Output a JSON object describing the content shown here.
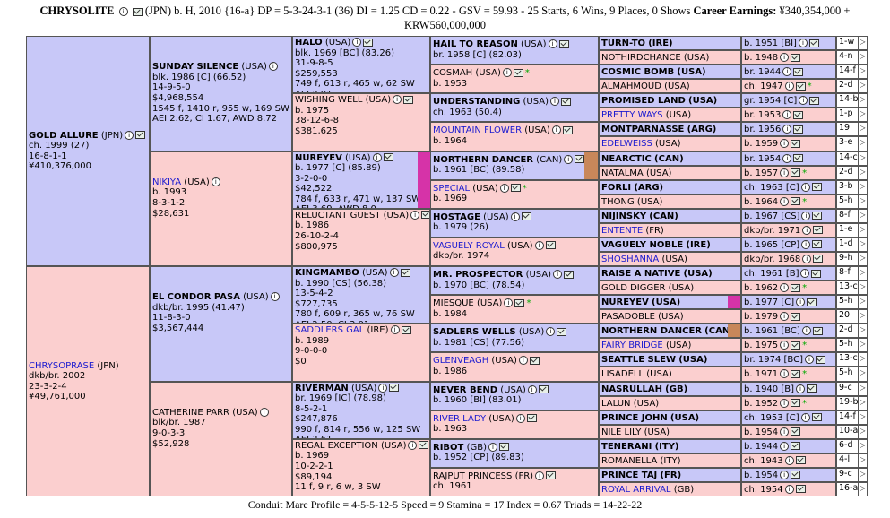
{
  "header": {
    "horse": "CHRYSOLITE",
    "line1": "(JPN) b. H, 2010 {16-a} DP = 5-3-24-3-1 (36) DI = 1.25   CD = 0.22 - GSV = 59.93 - 25 Starts, 6 Wins, 9 Places, 0 Shows",
    "earn_label": "Career Earnings:",
    "earn_value": "¥340,354,000 +",
    "line2": "KRW560,000,000"
  },
  "footer": "Conduit Mare Profile = 4-5-5-12-5   Speed = 9   Stamina = 17   Index = 0.67   Triads = 14-22-22",
  "gen1": {
    "sire": {
      "name": "GOLD ALLURE",
      "country": "(JPN)",
      "l1": "ch. 1999 (27)",
      "l2": "16-8-1-1",
      "l3": "¥410,376,000"
    },
    "dam": {
      "name": "CHRYSOPRASE",
      "country": "(JPN)",
      "l1": "dkb/br. 2002",
      "l2": "23-3-2-4",
      "l3": "¥49,761,000"
    }
  },
  "gen2": [
    {
      "name": "SUNDAY SILENCE",
      "country": "(USA)",
      "lines": [
        "blk. 1986 [C] (66.52)",
        "14-9-5-0",
        "$4,968,554",
        "1545 f, 1410 r, 955 w, 169 SW",
        "AEI 2.62, CI 1.67, AWD 8.72"
      ]
    },
    {
      "name": "NIKIYA",
      "country": "(USA)",
      "lines": [
        "b. 1993",
        "8-3-1-2",
        "$28,631"
      ]
    },
    {
      "name": "EL CONDOR PASA",
      "country": "(USA)",
      "lines": [
        "dkb/br. 1995 (41.47)",
        "11-8-3-0",
        "$3,567,444"
      ]
    },
    {
      "name": "CATHERINE PARR",
      "country": "(USA)",
      "lines": [
        "blk/br. 1987",
        "9-0-3-3",
        "$52,928"
      ]
    }
  ],
  "gen3": [
    {
      "name": "HALO",
      "country": "(USA)",
      "lines": [
        "blk. 1969 [BC] (83.26)",
        "31-9-8-5",
        "$259,553",
        "749 f, 613 r, 465 w, 62 SW",
        "AEI 2.91"
      ]
    },
    {
      "name": "WISHING WELL",
      "country": "(USA)",
      "lines": [
        "b. 1975",
        "38-12-6-8",
        "$381,625"
      ]
    },
    {
      "name": "NUREYEV",
      "country": "(USA)",
      "lines": [
        "b. 1977 [C] (85.89)",
        "3-2-0-0",
        "$42,522",
        "784 f, 633 r, 471 w, 137 SW",
        "AEI 3.69, AWD 8.0"
      ]
    },
    {
      "name": "RELUCTANT GUEST",
      "country": "(USA)",
      "lines": [
        "b. 1986",
        "26-10-2-4",
        "$800,975"
      ]
    },
    {
      "name": "KINGMAMBO",
      "country": "(USA)",
      "lines": [
        "b. 1990 [CS] (56.38)",
        "13-5-4-2",
        "$727,735",
        "780 f, 609 r, 365 w, 76 SW",
        "AEI 2.50, CI 3.01"
      ],
      "extra": "Website"
    },
    {
      "name": "SADDLERS GAL",
      "country": "(IRE)",
      "lines": [
        "b. 1989",
        "9-0-0-0",
        "$0"
      ]
    },
    {
      "name": "RIVERMAN",
      "country": "(USA)",
      "lines": [
        "br. 1969 [IC] (78.98)",
        "8-5-2-1",
        "$247,876",
        "990 f, 814 r, 556 w, 125 SW",
        "AEI 2.61"
      ]
    },
    {
      "name": "REGAL EXCEPTION",
      "country": "(USA)",
      "lines": [
        "b. 1969",
        "10-2-2-1",
        "$89,194",
        "11 f, 9 r, 6 w, 3 SW"
      ]
    }
  ],
  "gen4": [
    {
      "name": "HAIL TO REASON",
      "country": "(USA)",
      "line": "br. 1958 [C] (82.03)"
    },
    {
      "name": "COSMAH",
      "country": "(USA)",
      "line": "b. 1953"
    },
    {
      "name": "UNDERSTANDING",
      "country": "(USA)",
      "line": "ch. 1963 (50.4)"
    },
    {
      "name": "MOUNTAIN FLOWER",
      "country": "(USA)",
      "line": "b. 1964"
    },
    {
      "name": "NORTHERN DANCER",
      "country": "(CAN)",
      "line": "b. 1961 [BC] (89.58)"
    },
    {
      "name": "SPECIAL",
      "country": "(USA)",
      "line": "b. 1969"
    },
    {
      "name": "HOSTAGE",
      "country": "(USA)",
      "line": "b. 1979 (26)"
    },
    {
      "name": "VAGUELY ROYAL",
      "country": "(USA)",
      "line": "dkb/br. 1974"
    },
    {
      "name": "MR. PROSPECTOR",
      "country": "(USA)",
      "line": "b. 1970 [BC] (78.54)"
    },
    {
      "name": "MIESQUE",
      "country": "(USA)",
      "line": "b. 1984"
    },
    {
      "name": "SADLERS WELLS",
      "country": "(USA)",
      "line": "b. 1981 [CS] (77.56)"
    },
    {
      "name": "GLENVEAGH",
      "country": "(USA)",
      "line": "b. 1986"
    },
    {
      "name": "NEVER BEND",
      "country": "(USA)",
      "line": "b. 1960 [BI] (83.01)"
    },
    {
      "name": "RIVER LADY",
      "country": "(USA)",
      "line": "b. 1963"
    },
    {
      "name": "RIBOT",
      "country": "(GB)",
      "line": "b. 1952 [CP] (89.83)"
    },
    {
      "name": "RAJPUT PRINCESS",
      "country": "(FR)",
      "line": "ch. 1961"
    }
  ],
  "gen5": [
    {
      "name": "TURN-TO",
      "country": "(IRE)",
      "info": "b. 1951 [BI]",
      "cw": "1-w"
    },
    {
      "name": "NOTHIRDCHANCE",
      "country": "(USA)",
      "info": "b. 1948",
      "cw": "4-n"
    },
    {
      "name": "COSMIC BOMB",
      "country": "(USA)",
      "info": "br. 1944",
      "cw": "14-f"
    },
    {
      "name": "ALMAHMOUD",
      "country": "(USA)",
      "info": "ch. 1947",
      "cw": "2-d"
    },
    {
      "name": "PROMISED LAND",
      "country": "(USA)",
      "info": "gr. 1954 [C]",
      "cw": "14-b"
    },
    {
      "name": "PRETTY WAYS",
      "country": "(USA)",
      "info": "br. 1953",
      "cw": "1-p"
    },
    {
      "name": "MONTPARNASSE",
      "country": "(ARG)",
      "info": "br. 1956",
      "cw": "19"
    },
    {
      "name": "EDELWEISS",
      "country": "(USA)",
      "info": "b. 1959",
      "cw": "3-e"
    },
    {
      "name": "NEARCTIC",
      "country": "(CAN)",
      "info": "br. 1954",
      "cw": "14-c"
    },
    {
      "name": "NATALMA",
      "country": "(USA)",
      "info": "b. 1957",
      "cw": "2-d"
    },
    {
      "name": "FORLI",
      "country": "(ARG)",
      "info": "ch. 1963 [C]",
      "cw": "3-b"
    },
    {
      "name": "THONG",
      "country": "(USA)",
      "info": "b. 1964",
      "cw": "5-h"
    },
    {
      "name": "NIJINSKY",
      "country": "(CAN)",
      "info": "b. 1967 [CS]",
      "cw": "8-f"
    },
    {
      "name": "ENTENTE",
      "country": "(FR)",
      "info": "dkb/br. 1971",
      "cw": "1-e"
    },
    {
      "name": "VAGUELY NOBLE",
      "country": "(IRE)",
      "info": "b. 1965 [CP]",
      "cw": "1-d"
    },
    {
      "name": "SHOSHANNA",
      "country": "(USA)",
      "info": "dkb/br. 1968",
      "cw": "9-h"
    },
    {
      "name": "RAISE A NATIVE",
      "country": "(USA)",
      "info": "ch. 1961 [B]",
      "cw": "8-f"
    },
    {
      "name": "GOLD DIGGER",
      "country": "(USA)",
      "info": "b. 1962",
      "cw": "13-c"
    },
    {
      "name": "NUREYEV",
      "country": "(USA)",
      "info": "b. 1977 [C]",
      "cw": "5-h"
    },
    {
      "name": "PASADOBLE",
      "country": "(USA)",
      "info": "b. 1979",
      "cw": "20"
    },
    {
      "name": "NORTHERN DANCER",
      "country": "(CAN)",
      "info": "b. 1961 [BC]",
      "cw": "2-d"
    },
    {
      "name": "FAIRY BRIDGE",
      "country": "(USA)",
      "info": "b. 1975",
      "cw": "5-h"
    },
    {
      "name": "SEATTLE SLEW",
      "country": "(USA)",
      "info": "br. 1974 [BC]",
      "cw": "13-c"
    },
    {
      "name": "LISADELL",
      "country": "(USA)",
      "info": "b. 1971",
      "cw": "5-h"
    },
    {
      "name": "NASRULLAH",
      "country": "(GB)",
      "info": "b. 1940 [B]",
      "cw": "9-c"
    },
    {
      "name": "LALUN",
      "country": "(USA)",
      "info": "b. 1952",
      "cw": "19-b"
    },
    {
      "name": "PRINCE JOHN",
      "country": "(USA)",
      "info": "ch. 1953 [C]",
      "cw": "14-f"
    },
    {
      "name": "NILE LILY",
      "country": "(USA)",
      "info": "b. 1954",
      "cw": "10-a"
    },
    {
      "name": "TENERANI",
      "country": "(ITY)",
      "info": "b. 1944",
      "cw": "6-d"
    },
    {
      "name": "ROMANELLA",
      "country": "(ITY)",
      "info": "ch. 1943",
      "cw": "4-l"
    },
    {
      "name": "PRINCE TAJ",
      "country": "(FR)",
      "info": "b. 1954",
      "cw": "9-c"
    },
    {
      "name": "ROYAL ARRIVAL",
      "country": "(GB)",
      "info": "ch. 1954",
      "cw": "16-a"
    }
  ],
  "icons": {
    "info": "info-icon",
    "email": "email-icon",
    "star": "star-icon",
    "arrow": "arrow-right-icon"
  },
  "colors": {
    "male": "#c8c8f8",
    "female": "#fbcfcf",
    "link": "#1a1ad0",
    "star": "#00aa00",
    "nureyev_bar": "#d633a8",
    "dancer_bar": "#c8875a"
  }
}
